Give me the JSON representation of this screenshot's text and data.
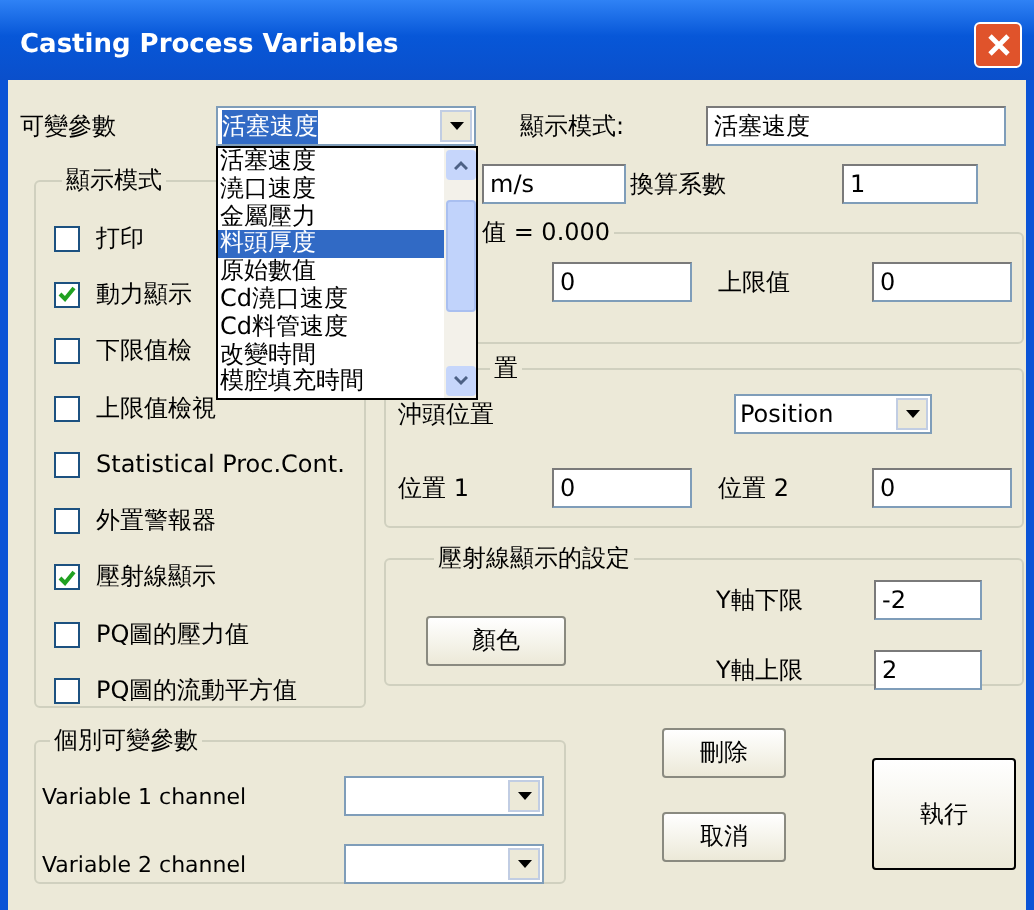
{
  "window": {
    "title": "Casting Process Variables"
  },
  "variable_select": {
    "label": "可變參數",
    "value": "活塞速度",
    "open": true
  },
  "dropdown_list": [
    {
      "label": "活塞速度",
      "selected": false
    },
    {
      "label": "澆口速度",
      "selected": false
    },
    {
      "label": "金屬壓力",
      "selected": false
    },
    {
      "label": "料頭厚度",
      "selected": true
    },
    {
      "label": "原始數值",
      "selected": false
    },
    {
      "label": "Cd澆口速度",
      "selected": false
    },
    {
      "label": "Cd料管速度",
      "selected": false
    },
    {
      "label": "改變時間",
      "selected": false
    },
    {
      "label": "模腔填充時間",
      "selected": false
    }
  ],
  "display_mode": {
    "label": "顯示模式:",
    "value": "活塞速度"
  },
  "display_group": {
    "title": "顯示模式",
    "options": [
      {
        "label": "打印",
        "checked": false
      },
      {
        "label": "動力顯示",
        "checked": true
      },
      {
        "label": "下限值檢",
        "checked": false
      },
      {
        "label": "上限值檢視",
        "checked": false
      },
      {
        "label": "Statistical Proc.Cont.",
        "checked": false
      },
      {
        "label": "外置警報器",
        "checked": false
      },
      {
        "label": "壓射線顯示",
        "checked": true
      },
      {
        "label": "PQ圖的壓力值",
        "checked": false
      },
      {
        "label": "PQ圖的流動平方值",
        "checked": false
      }
    ]
  },
  "unit_field": {
    "value": "m/s"
  },
  "conversion": {
    "label": "換算系數",
    "value": "1"
  },
  "limits_group": {
    "title": "值 = 0.000",
    "lower_value": "0",
    "upper_label": "上限值",
    "upper_value": "0"
  },
  "position_group": {
    "title": "置",
    "plunger_label": "沖頭位置",
    "plunger_select": "Position",
    "pos1_label": "位置 1",
    "pos1_value": "0",
    "pos2_label": "位置 2",
    "pos2_value": "0"
  },
  "shot_group": {
    "title": "壓射線顯示的設定",
    "color_button": "顏色",
    "y_min_label": "Y軸下限",
    "y_min": "-2",
    "y_max_label": "Y軸上限",
    "y_max": "2"
  },
  "channels_group": {
    "title": "個別可變參數",
    "channels": [
      {
        "label": "Variable 1 channel"
      },
      {
        "label": "Variable 2 channel"
      }
    ]
  },
  "buttons": {
    "delete": "刪除",
    "cancel": "取消",
    "run": "執行"
  }
}
